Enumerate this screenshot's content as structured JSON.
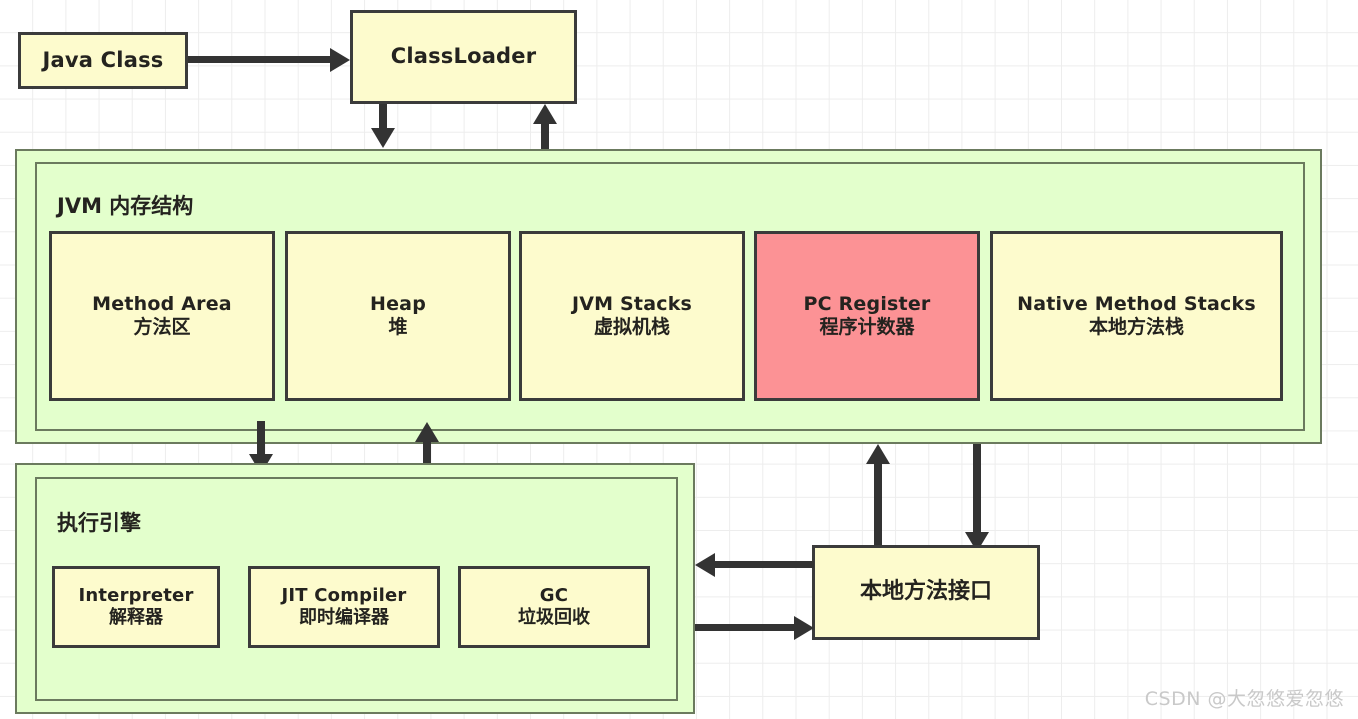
{
  "diagram": {
    "title_watermark": "CSDN @大忽悠爱忽悠",
    "colors": {
      "box_yellow": "#fdfbcd",
      "box_red": "#fc9295",
      "panel_green": "#e3ffcc",
      "border_dark": "#3b3b3b",
      "border_green": "#6b7a5e",
      "arrow": "#333333",
      "grid": "#ededed",
      "watermark": "#c9c9c9"
    }
  },
  "nodes": {
    "java_class": {
      "label": "Java Class"
    },
    "class_loader": {
      "label": "ClassLoader"
    },
    "native_interface": {
      "label": "本地方法接口"
    }
  },
  "jvm_memory": {
    "title": "JVM 内存结构",
    "areas": [
      {
        "en": "Method Area",
        "cn": "方法区",
        "fill": "yellow"
      },
      {
        "en": "Heap",
        "cn": "堆",
        "fill": "yellow"
      },
      {
        "en": "JVM Stacks",
        "cn": "虚拟机栈",
        "fill": "yellow"
      },
      {
        "en": "PC Register",
        "cn": "程序计数器",
        "fill": "red"
      },
      {
        "en": "Native Method Stacks",
        "cn": "本地方法栈",
        "fill": "yellow"
      }
    ]
  },
  "execution_engine": {
    "title": "执行引擎",
    "components": [
      {
        "en": "Interpreter",
        "cn": "解释器",
        "fill": "yellow"
      },
      {
        "en": "JIT Compiler",
        "cn": "即时编译器",
        "fill": "yellow"
      },
      {
        "en": "GC",
        "cn": "垃圾回收",
        "fill": "yellow"
      }
    ]
  },
  "arrows": [
    {
      "name": "java-class-to-classloader",
      "direction": "right"
    },
    {
      "name": "classloader-to-jvm-memory",
      "direction": "down"
    },
    {
      "name": "jvm-memory-to-classloader",
      "direction": "up"
    },
    {
      "name": "jvm-memory-to-execution-engine",
      "direction": "down"
    },
    {
      "name": "execution-engine-to-jvm-memory",
      "direction": "up"
    },
    {
      "name": "native-interface-to-jvm-memory",
      "direction": "up"
    },
    {
      "name": "jvm-memory-to-native-interface",
      "direction": "down"
    },
    {
      "name": "native-interface-to-execution-engine",
      "direction": "left"
    },
    {
      "name": "execution-engine-to-native-interface",
      "direction": "right"
    }
  ]
}
